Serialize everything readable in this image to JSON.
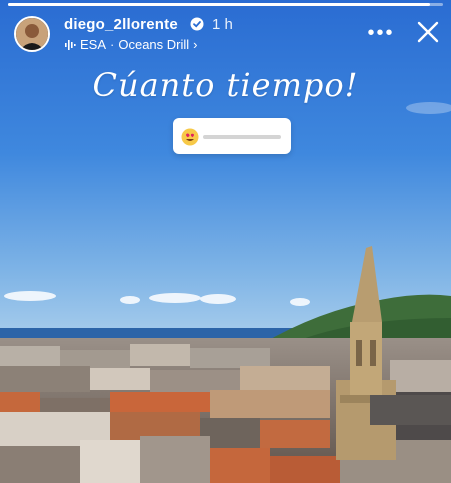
{
  "story": {
    "progress": 0.97
  },
  "header": {
    "username": "diego_2llorente",
    "time": "1 h",
    "music": {
      "artist": "ESA",
      "separator": "·",
      "track": "Oceans Drill",
      "chevron": "›"
    },
    "more_label": "•••"
  },
  "overlay": {
    "title": "Cúanto tiempo!"
  },
  "slider": {
    "emoji": "smiling-face-with-heart-eyes",
    "value": 0
  },
  "colors": {
    "sky_top": "#2a6fd4",
    "sky_bottom": "#8bbbe8",
    "sea": "#2a62a8",
    "roof": "#c9643a",
    "verified": "#3897f0"
  }
}
